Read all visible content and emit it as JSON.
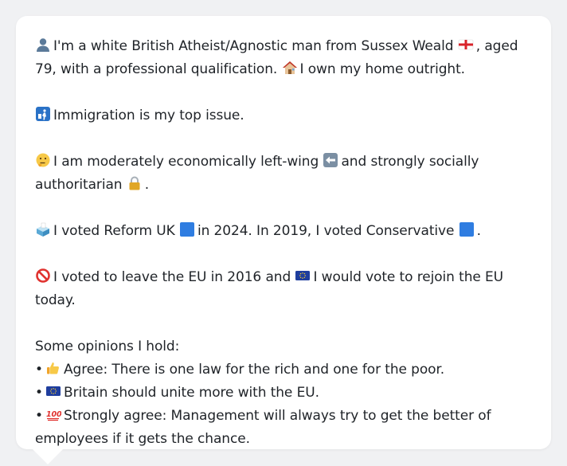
{
  "profile": {
    "line1_a": "I'm a white British Atheist/Agnostic man from Sussex Weald",
    "line1_b": ", aged 79, with a professional qualification.",
    "line1_c": "I own my home outright.",
    "line2": "Immigration is my top issue.",
    "line3_a": "I am moderately economically left-wing",
    "line3_b": "and strongly socially authoritarian",
    "line3_c": ".",
    "line4_a": "I voted Reform UK",
    "line4_b": "in 2024. In 2019, I voted Conservative",
    "line4_c": ".",
    "line5_a": "I voted to leave the EU in 2016 and",
    "line5_b": "I would vote to rejoin the EU today."
  },
  "opinions": {
    "heading": "Some opinions I hold:",
    "bullet_char": "•",
    "items": [
      {
        "icon": "thumbs-up-icon",
        "text": "Agree: There is one law for the rich and one for the poor."
      },
      {
        "icon": "eu-flag-icon",
        "text": "Britain should unite more with the EU."
      },
      {
        "icon": "hundred-icon",
        "text": "Strongly agree: Management will always try to get the better of employees if it gets the chance."
      }
    ]
  },
  "colors": {
    "reform_uk": "#2f7de1",
    "conservative": "#2f7de1",
    "card_bg": "#ffffff",
    "page_bg": "#f0f1f3"
  }
}
